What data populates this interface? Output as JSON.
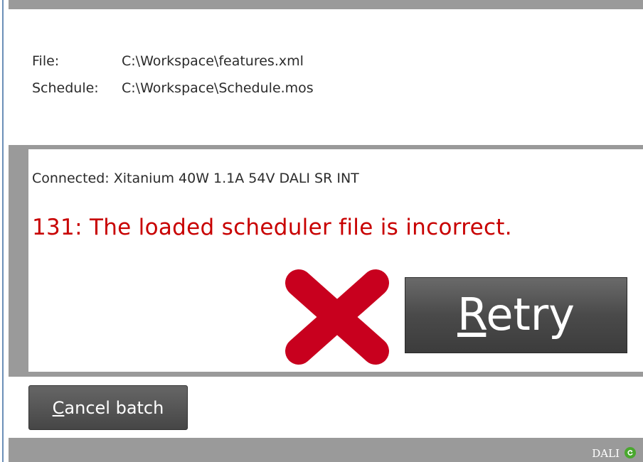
{
  "info": {
    "file_label": "File:",
    "file_value": "C:\\Workspace\\features.xml",
    "schedule_label": "Schedule:",
    "schedule_value": "C:\\Workspace\\Schedule.mos"
  },
  "status": {
    "connected_text": "Connected: Xitanium 40W 1.1A 54V DALI SR INT",
    "error_text": "131: The loaded scheduler file is incorrect.",
    "error_color": "#c80000",
    "result_icon": "red-x-icon"
  },
  "retry_button": {
    "accel": "R",
    "rest": "etry"
  },
  "cancel_button": {
    "accel": "C",
    "rest": "ancel batch"
  },
  "status_bar": {
    "dali_label": "DALI",
    "dali_icon": "green-refresh-icon",
    "dali_color": "#49a82e"
  }
}
